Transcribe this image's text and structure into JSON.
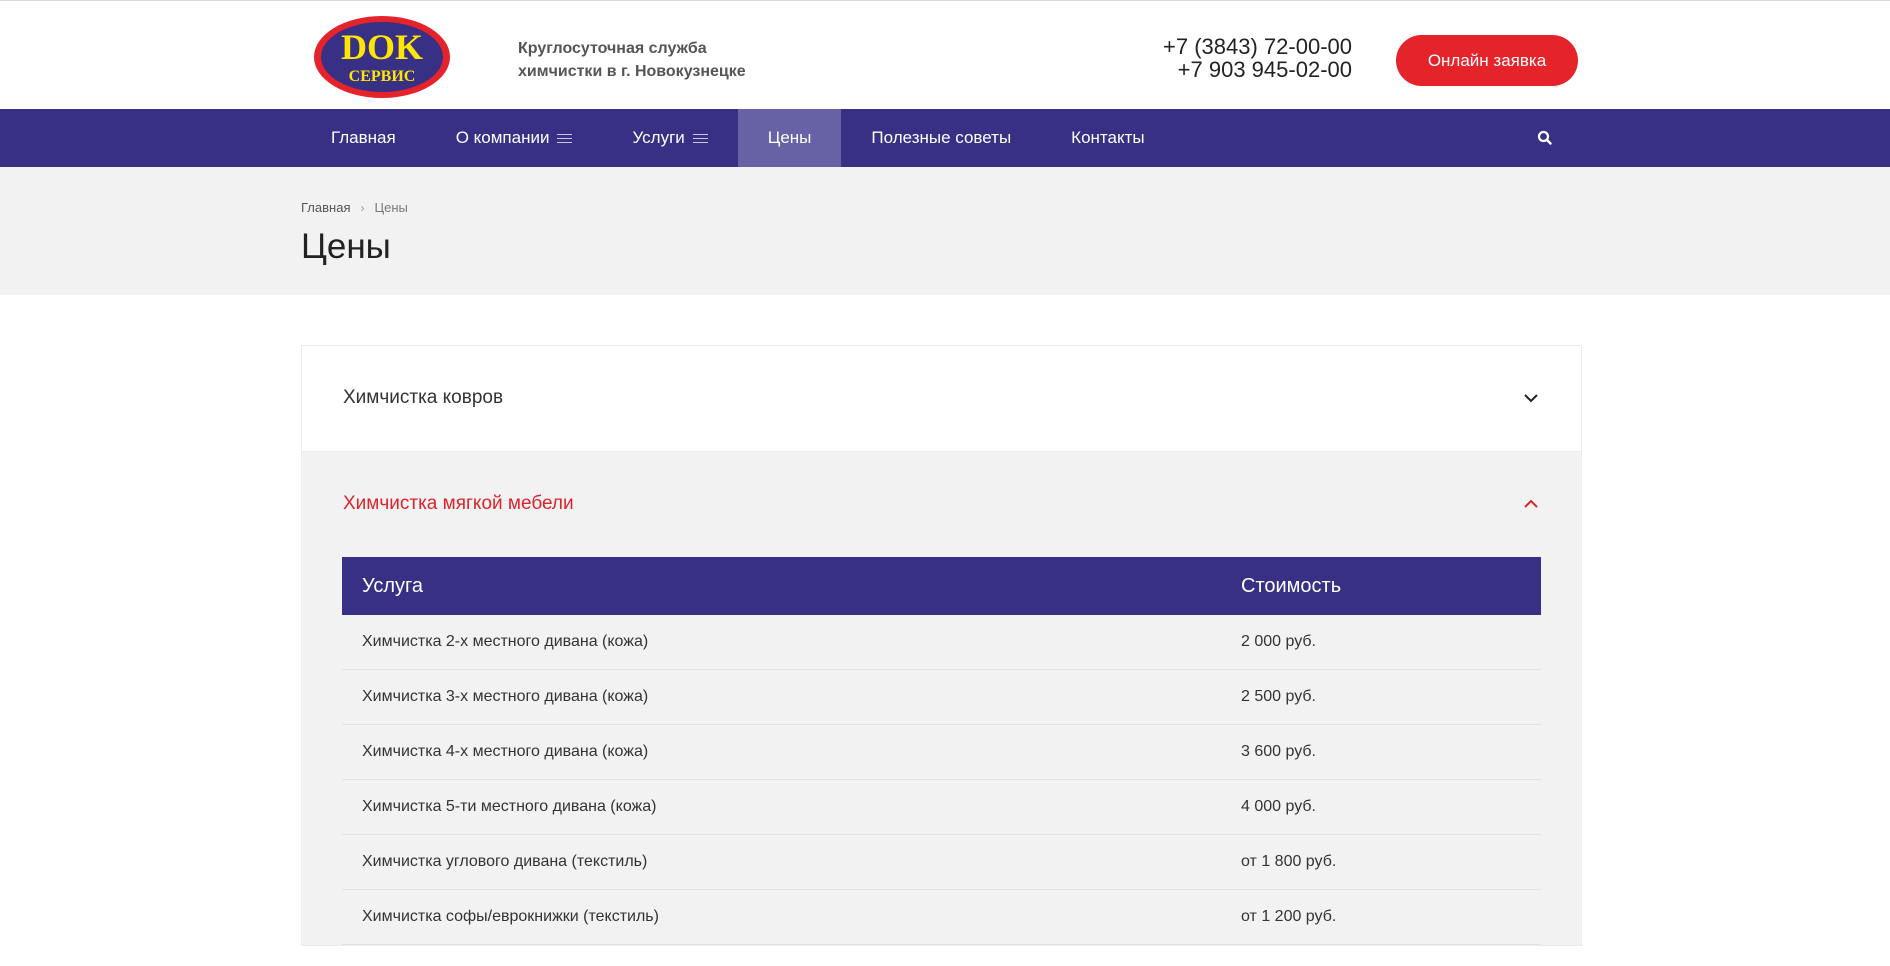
{
  "header": {
    "logo": {
      "text_top": "DOK",
      "text_bottom": "СЕРВИС",
      "colors": {
        "ring": "#e4232a",
        "fill": "#383085",
        "text": "#ffe600"
      }
    },
    "tagline_line1": "Круглосуточная служба",
    "tagline_line2": "химчистки в г. Новокузнецке",
    "phone1": "+7 (3843) 72-00-00",
    "phone2": "+7 903 945-02-00",
    "cta_label": "Онлайн заявка"
  },
  "nav": {
    "items": [
      {
        "label": "Главная",
        "has_menu": false
      },
      {
        "label": "О компании",
        "has_menu": true
      },
      {
        "label": "Услуги",
        "has_menu": true
      },
      {
        "label": "Цены",
        "has_menu": false,
        "active": true
      },
      {
        "label": "Полезные советы",
        "has_menu": false
      },
      {
        "label": "Контакты",
        "has_menu": false
      }
    ],
    "search_icon": "search-icon"
  },
  "breadcrumb": {
    "home": "Главная",
    "current": "Цены"
  },
  "page_title": "Цены",
  "accordion": {
    "sections": [
      {
        "title": "Химчистка ковров",
        "expanded": false
      },
      {
        "title": "Химчистка мягкой мебели",
        "expanded": true
      }
    ],
    "table": {
      "headers": [
        "Услуга",
        "Стоимость"
      ],
      "rows": [
        [
          "Химчистка 2-х местного дивана (кожа)",
          "2 000 руб."
        ],
        [
          "Химчистка 3-х местного дивана (кожа)",
          "2 500 руб."
        ],
        [
          "Химчистка 4-х местного дивана (кожа)",
          "3 600 руб."
        ],
        [
          "Химчистка 5-ти местного дивана (кожа)",
          "4 000 руб."
        ],
        [
          "Химчистка углового дивана (текстиль)",
          "от 1 800 руб."
        ],
        [
          "Химчистка софы/еврокнижки (текстиль)",
          "от 1 200 руб."
        ]
      ]
    }
  },
  "colors": {
    "brand_blue": "#383085",
    "accent_red": "#e4232a",
    "nav_active": "#6761a5"
  }
}
